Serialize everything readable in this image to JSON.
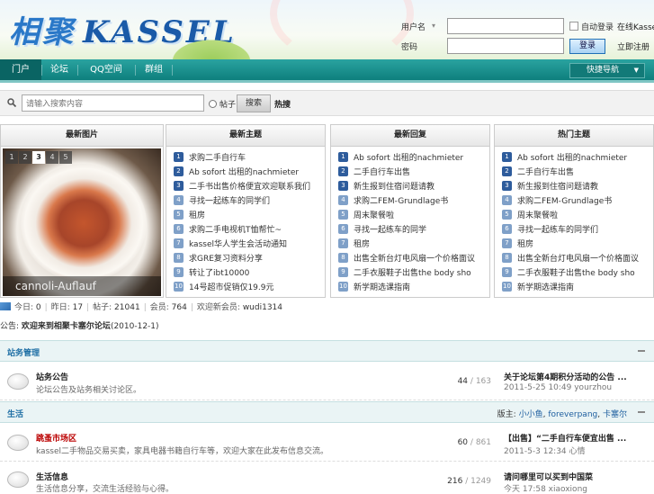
{
  "header": {
    "logo_cjk": "相聚",
    "logo_text": "KASSEL",
    "login": {
      "user_label": "用户名",
      "user_dropdown": "▾",
      "pass_label": "密码",
      "remember_label": "自动登录",
      "login_button": "登录",
      "side_text": "在线Kassel",
      "side_text2": "立即注册"
    }
  },
  "nav": {
    "items": [
      "门户",
      "论坛",
      "QQ空间",
      "群组"
    ],
    "quick": "快捷导航"
  },
  "search": {
    "placeholder": "请输入搜索内容",
    "radio_label": "帖子",
    "button": "搜索",
    "hot_label": "热搜"
  },
  "panels": {
    "slide_title": "最新图片",
    "slide_nums": [
      "1",
      "2",
      "3",
      "4",
      "5"
    ],
    "slide_active": "3",
    "slide_caption": "cannoli-Auflauf",
    "list1": {
      "title": "最新主题",
      "items": [
        "求购二手自行车",
        "Ab sofort 出租的nachmieter",
        "二手书出售价格便宜欢迎联系我们",
        "寻找一起练车的同学们",
        "租房",
        "求购二手电视机T恤帮忙~",
        "kassel华人学生会活动通知",
        "求GRE复习资料分享",
        "转让了ibt10000",
        "14号超市促销仅19.9元"
      ]
    },
    "list2": {
      "title": "最新回复",
      "items": [
        "Ab sofort 出租的nachmieter",
        "二手自行车出售",
        "新生报到住宿问题请教",
        "求购二FEM-Grundlage书",
        "周末聚餐啦",
        "寻找一起练车的同学",
        "租房",
        "出售全新台灯电风扇一个价格面议",
        "二手衣服鞋子出售the body sho",
        "新学期选课指南"
      ]
    },
    "list3": {
      "title": "热门主题",
      "items": [
        "Ab sofort 出租的nachmieter",
        "二手自行车出售",
        "新生报到住宿问题请教",
        "求购二FEM-Grundlage书",
        "周末聚餐啦",
        "寻找一起练车的同学们",
        "租房",
        "出售全新台灯电风扇一个价格面议",
        "二手衣服鞋子出售the body sho",
        "新学期选课指南"
      ]
    }
  },
  "stats": {
    "today_label": "今日",
    "today": "0",
    "yesterday_label": "昨日",
    "yesterday": "17",
    "posts_label": "帖子",
    "posts": "21041",
    "members_label": "会员",
    "members": "764",
    "newest_label": "欢迎新会员",
    "newest": "wudi1314"
  },
  "notice": {
    "prefix": "公告:",
    "text": "欢迎来到相聚卡塞尔论坛",
    "date": "(2010-12-1)"
  },
  "blocks": [
    {
      "title": "站务管理",
      "moderators_label": "",
      "moderators": [],
      "rows": [
        {
          "name": "站务公告",
          "red": false,
          "desc": "论坛公告及站务相关讨论区。",
          "threads": "44",
          "posts": "163",
          "last_title": "关于论坛第4期积分活动的公告 ...",
          "last_meta": "2011-5-25 10:49 yourzhou"
        }
      ]
    },
    {
      "title": "生活",
      "moderators_label": "版主:",
      "moderators": [
        "小小鱼",
        "foreverpang",
        "卡塞尔"
      ],
      "rows": [
        {
          "name": "跳蚤市场区",
          "red": true,
          "desc": "kassel二手物品交易买卖，家具电器书籍自行车等，欢迎大家在此发布信息交流。",
          "threads": "60",
          "posts": "861",
          "last_title": "【出售】“二手自行车便宜出售 ...",
          "last_meta": "2011-5-3 12:34 心情"
        },
        {
          "name": "生活信息",
          "red": false,
          "desc": "生活信息分享，交流生活经验与心得。",
          "threads": "216",
          "posts": "1249",
          "last_title": "请问哪里可以买到中国菜",
          "last_meta": "今天 17:58 xiaoxiong"
        }
      ]
    }
  ],
  "colors": {
    "nav": "#0e7f7d",
    "link": "#2060a0",
    "block_header": "#eaf4f5"
  }
}
